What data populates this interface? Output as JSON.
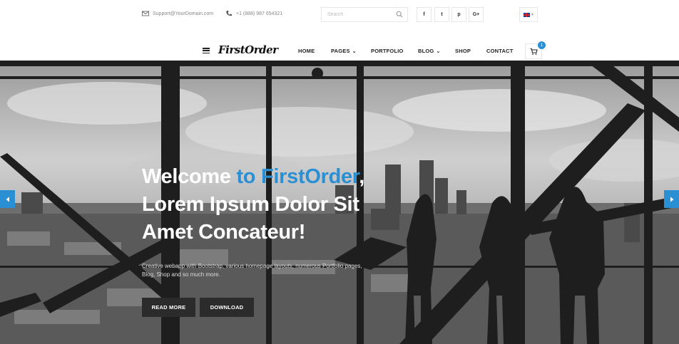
{
  "topbar": {
    "email": "Support@YourDomain.com",
    "phone": "+1 (888) 987 654321",
    "search_placeholder": "Search",
    "social": [
      "f",
      "t",
      "p",
      "G+"
    ]
  },
  "nav": {
    "logo": "FirstOrder",
    "items": [
      "HOME",
      "PAGES",
      "PORTFOLIO",
      "BLOG",
      "SHOP",
      "CONTACT"
    ],
    "cart_count": "1"
  },
  "hero": {
    "headline_white1": "Welcome ",
    "headline_accent": "to FirstOrder",
    "headline_white2": ",",
    "headline_line2": "Lorem Ipsum Dolor Sit",
    "headline_line3": "Amet Concateur!",
    "subtitle": "Creative webapp with Bootstrap, various homepage layouts, numerous Portfolio pages, Blog, Shop and so much more.",
    "btn_primary": "READ MORE",
    "btn_secondary": "DOWNLOAD"
  },
  "colors": {
    "accent": "#2b8fd4",
    "button": "#2b2b2b"
  }
}
